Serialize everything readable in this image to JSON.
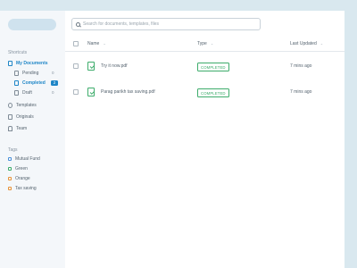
{
  "search": {
    "placeholder": "Search for documents, templates, files",
    "value": ""
  },
  "sidebar": {
    "shortcuts_title": "Shortcuts",
    "items": [
      {
        "label": "My Documents",
        "active": true
      },
      {
        "label": "Pending",
        "count": "0"
      },
      {
        "label": "Completed",
        "count": "2",
        "active": true
      },
      {
        "label": "Draft",
        "count": "0"
      },
      {
        "label": "Templates"
      },
      {
        "label": "Originals"
      },
      {
        "label": "Team"
      }
    ],
    "tags_title": "Tags",
    "tags": [
      {
        "label": "Mutual Fund",
        "color": "#4a90d9"
      },
      {
        "label": "Green",
        "color": "#3dac6b"
      },
      {
        "label": "Orange",
        "color": "#e8923a"
      },
      {
        "label": "Tax saving",
        "color": "#e8923a"
      }
    ]
  },
  "table": {
    "columns": {
      "name": "Name",
      "type": "Type",
      "last_updated": "Last Updated"
    },
    "rows": [
      {
        "name": "Try it now.pdf",
        "status": "COMPLETED",
        "updated": "7 mins ago"
      },
      {
        "name": "Parag parikh tax saving.pdf",
        "status": "COMPLETED",
        "updated": "7 mins ago"
      }
    ]
  },
  "colors": {
    "accent": "#1f86c7",
    "status_green": "#3dac6b",
    "background": "#d9e8ef"
  }
}
